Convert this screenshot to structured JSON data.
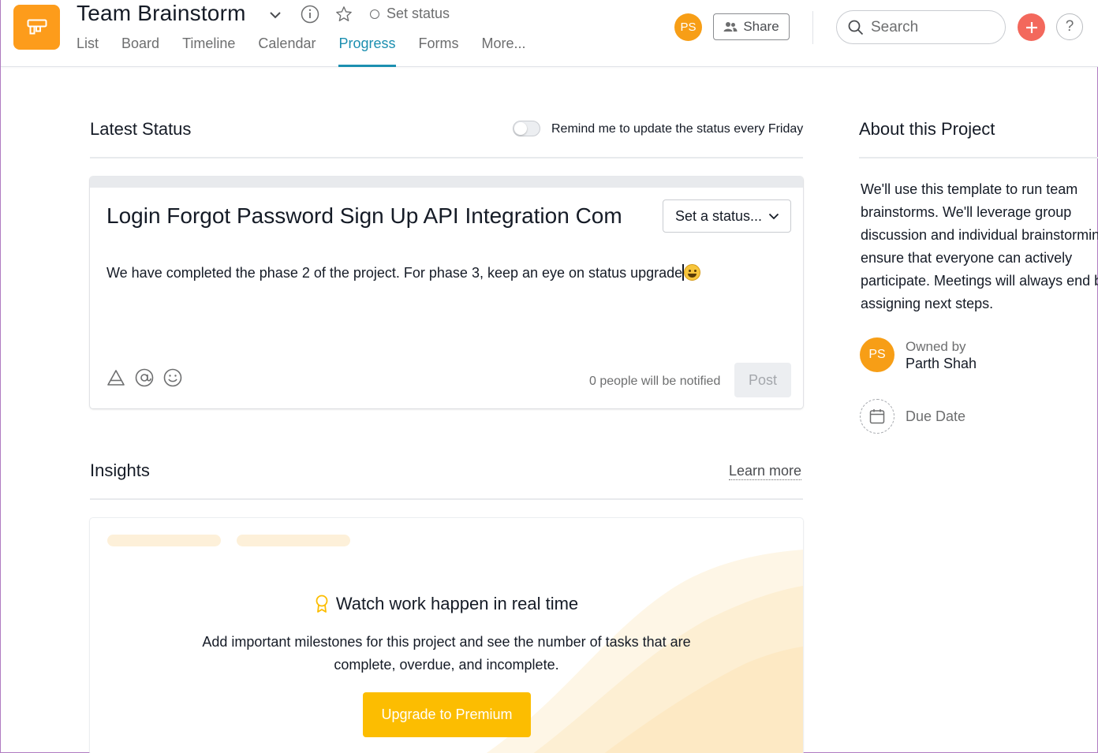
{
  "header": {
    "project_title": "Team Brainstorm",
    "set_status": "Set status",
    "tabs": [
      "List",
      "Board",
      "Timeline",
      "Calendar",
      "Progress",
      "Forms",
      "More..."
    ],
    "active_tab": "Progress",
    "user_initials": "PS",
    "share_label": "Share",
    "search_placeholder": "Search",
    "help_label": "?",
    "brand_color": "#fd9c1b",
    "accent_color": "#1c8fb0"
  },
  "latest_status": {
    "title": "Latest Status",
    "remind_label": "Remind me to update the status every Friday",
    "remind_enabled": false,
    "status_title": "Login Forgot Password Sign Up API Integration Com",
    "status_select": "Set a status...",
    "body": "We have completed the phase 2 of the project. For phase 3, keep an eye on status upgrade",
    "notified": "0 people will be notified",
    "post_label": "Post"
  },
  "insights": {
    "title": "Insights",
    "learn_more": "Learn more",
    "watch_title": "Watch work happen in real time",
    "watch_desc": "Add important milestones for this project and see the number of tasks that are complete, overdue, and incomplete.",
    "upgrade_label": "Upgrade to Premium",
    "upgrade_color": "#fcbd01"
  },
  "about": {
    "title": "About this Project",
    "description_lines": [
      "We'll use this template to run team",
      "brainstorms. We'll leverage group",
      "discussion and individual brainstorming to",
      "ensure that everyone can actively",
      "participate. Meetings will always end by",
      "assigning next steps."
    ],
    "owned_by_label": "Owned by",
    "owner_name": "Parth Shah",
    "owner_initials": "PS",
    "due_date_label": "Due Date"
  }
}
